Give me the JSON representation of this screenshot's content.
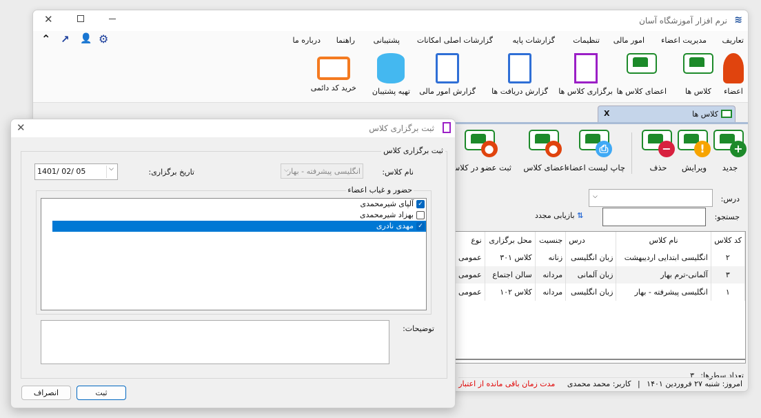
{
  "app": {
    "title": "نرم افزار آموزشگاه آسان"
  },
  "menu": [
    "تعاریف",
    "مدیریت اعضاء",
    "امور مالی",
    "تنظیمات",
    "گزارشات پایه",
    "گزارشات اصلی",
    "امکانات",
    "پشتیبانی",
    "راهنما",
    "درباره ما"
  ],
  "ribbon": [
    "اعضاء",
    "کلاس ها",
    "اعضای کلاس ها",
    "برگزاری کلاس ها",
    "گزارش دریافت ها",
    "گزارش امور مالی",
    "تهیه پشتیبان",
    "خرید کد دائمی"
  ],
  "tab": {
    "label": "کلاس ها",
    "close": "X"
  },
  "toolbar": [
    "جدید",
    "ویرایش",
    "حذف",
    "چاپ لیست اعضاء",
    "اعضای کلاس",
    "ثبت عضو در کلاس"
  ],
  "filter": {
    "course_label": "درس:",
    "course_value": "",
    "search_label": "جستجو:",
    "search_value": "",
    "refresh": "بازیابی مجدد"
  },
  "grid": {
    "columns": [
      "کد کلاس",
      "نام کلاس",
      "درس",
      "جنسیت",
      "محل برگزاری",
      "نوع"
    ],
    "rows": [
      [
        "۲",
        "انگلیسی ابتدایی اردیبهشت",
        "زبان انگلیسی",
        "زنانه",
        "کلاس ۳۰۱",
        "عمومی"
      ],
      [
        "۳",
        "آلمانی-ترم بهار",
        "زبان آلمانی",
        "مردانه",
        "سالن اجتماع",
        "عمومی"
      ],
      [
        "۱",
        "انگلیسی پیشرفته - بهار",
        "زبان انگلیسی",
        "مردانه",
        "کلاس ۱۰۲",
        "عمومی"
      ]
    ]
  },
  "rowcount": {
    "label": "تعداد سطرها:",
    "value": "۳"
  },
  "status": {
    "today": "امروز: شنبه ۲۷ فروردین ۱۴۰۱",
    "user": "کاربر: محمد محمدی",
    "warning": "مدت زمان باقی مانده از اعتبار"
  },
  "colors": {
    "accent": "#0067c0",
    "warning": "#e00000",
    "green": "#1d8a2a"
  },
  "dialog": {
    "title": "ثبت برگزاری کلاس",
    "group": "ثبت برگزاری کلاس",
    "class_label": "نام کلاس:",
    "class_value": "انگلیسی پیشرفته - بهار",
    "date_label": "تاریخ برگزاری:",
    "date_value": "1401/ 02/ 05",
    "attendance_group": "حضور و غیاب اعضاء",
    "members": [
      {
        "name": "آلپای شیرمحمدی",
        "checked": true
      },
      {
        "name": "بهزاد شیرمحمدی",
        "checked": false
      },
      {
        "name": "مهدی نادری",
        "checked": true,
        "selected": true
      }
    ],
    "notes_label": "توضیحات:",
    "notes_value": "",
    "save": "ثبت",
    "cancel": "انصراف"
  }
}
